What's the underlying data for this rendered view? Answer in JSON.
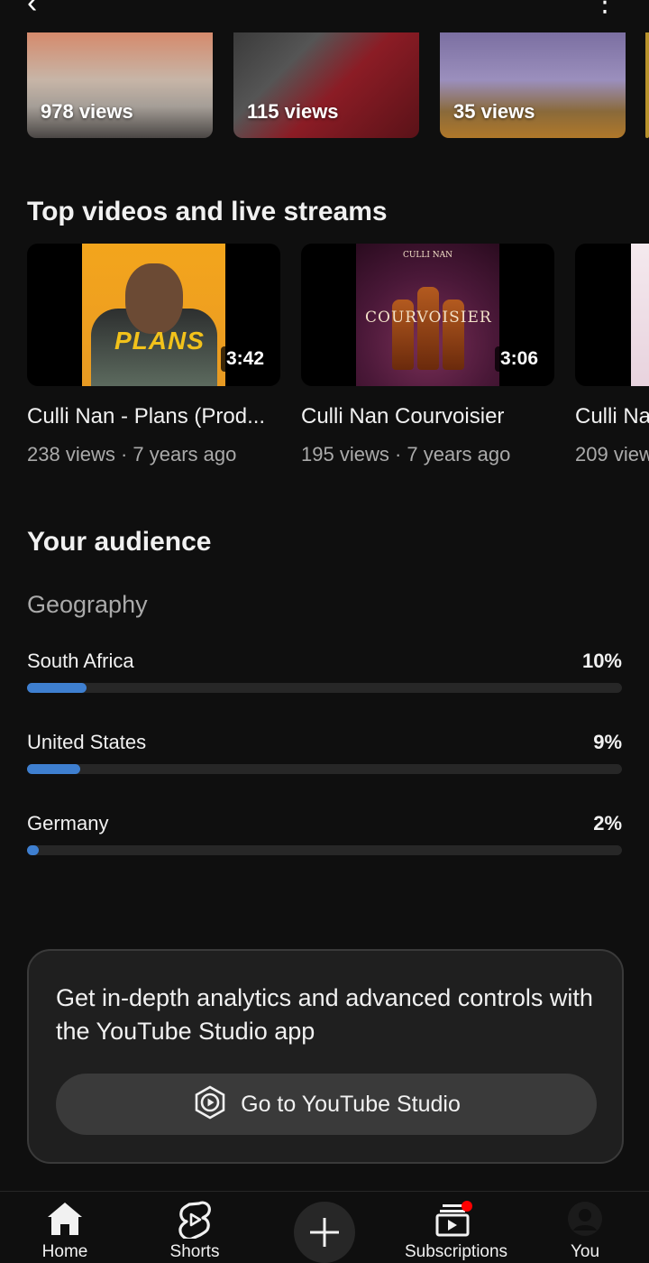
{
  "top": {
    "back_icon": "chevron-left-icon",
    "more_icon": "more-vert-icon"
  },
  "shorts": [
    {
      "views": "978 views"
    },
    {
      "views": "115 views"
    },
    {
      "views": "35 views"
    }
  ],
  "top_videos": {
    "title": "Top videos and live streams",
    "items": [
      {
        "title": "Culli Nan - Plans (Prod...",
        "meta": "238 views · 7 years ago",
        "duration": "3:42",
        "art_text": "PLANS"
      },
      {
        "title": "Culli Nan Courvoisier",
        "meta": "195 views · 7 years ago",
        "duration": "3:06",
        "art_text": "COURVOISIER",
        "art_top": "CULLI NAN"
      },
      {
        "title": "Culli Na",
        "meta": "209 view"
      }
    ]
  },
  "audience": {
    "title": "Your audience",
    "geography_title": "Geography",
    "countries": [
      {
        "name": "South Africa",
        "pct": "10%",
        "value": 10
      },
      {
        "name": "United States",
        "pct": "9%",
        "value": 9
      },
      {
        "name": "Germany",
        "pct": "2%",
        "value": 2
      }
    ]
  },
  "promo": {
    "text": "Get in-depth analytics and advanced controls with the YouTube Studio app",
    "button_label": "Go to YouTube Studio"
  },
  "nav": {
    "home": "Home",
    "shorts": "Shorts",
    "subscriptions": "Subscriptions",
    "you": "You"
  },
  "colors": {
    "accent": "#3e7fd0",
    "background": "#0f0f0f",
    "badge": "#ff0000"
  }
}
